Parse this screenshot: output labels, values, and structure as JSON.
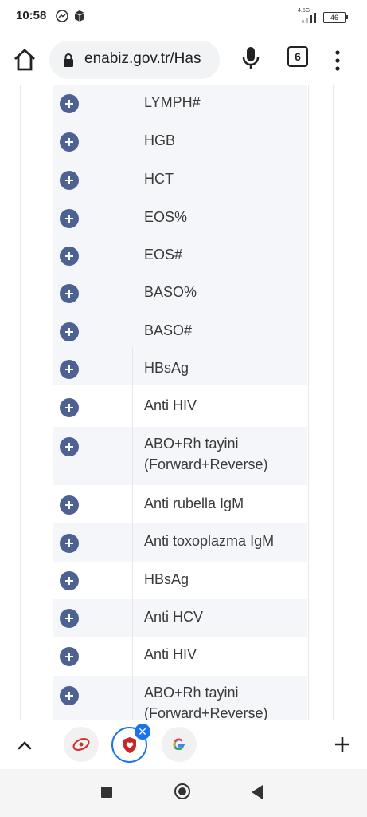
{
  "status": {
    "time": "10:58",
    "network": "4.5G",
    "battery": "46"
  },
  "browser": {
    "url": "enabiz.gov.tr/Has",
    "tab_count": "6"
  },
  "rows": [
    {
      "label": "LYMPH#"
    },
    {
      "label": "HGB"
    },
    {
      "label": "HCT"
    },
    {
      "label": "EOS%"
    },
    {
      "label": "EOS#"
    },
    {
      "label": "BASO%"
    },
    {
      "label": "BASO#"
    },
    {
      "label": "HBsAg"
    },
    {
      "label": "Anti HIV"
    },
    {
      "label": "ABO+Rh tayini",
      "label2": "(Forward+Reverse)"
    },
    {
      "label": "Anti rubella IgM"
    },
    {
      "label": "Anti toxoplazma IgM"
    },
    {
      "label": "HBsAg"
    },
    {
      "label": "Anti HCV"
    },
    {
      "label": "Anti HIV"
    },
    {
      "label": "ABO+Rh tayini",
      "label2": "(Forward+Reverse)"
    }
  ],
  "tabstrip": {
    "tabs": [
      {
        "icon": "enabiz-logo-icon"
      },
      {
        "icon": "shield-heart-icon",
        "active": true
      },
      {
        "icon": "google-g-icon"
      }
    ]
  }
}
